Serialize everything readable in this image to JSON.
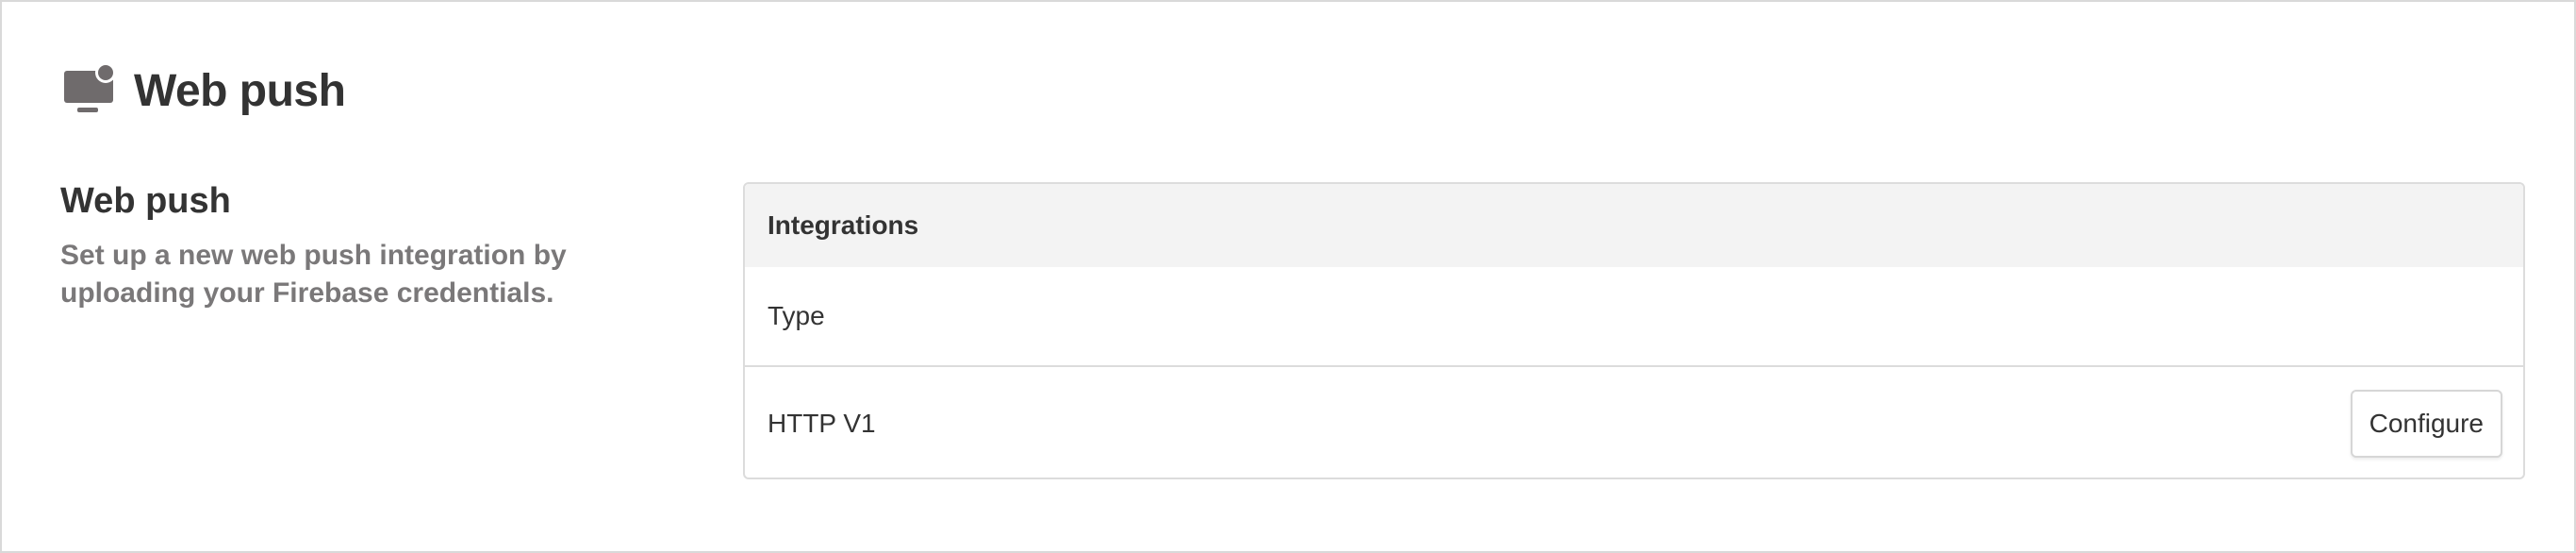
{
  "header": {
    "icon": "monitor-notification-icon",
    "title": "Web push"
  },
  "section": {
    "title": "Web push",
    "description_line1": "Set up a new web push integration by",
    "description_line2": "uploading your Firebase credentials."
  },
  "integrations": {
    "header": "Integrations",
    "column_label": "Type",
    "rows": [
      {
        "type": "HTTP V1",
        "action_label": "Configure"
      }
    ]
  },
  "colors": {
    "icon": "#6f6b6c",
    "text": "#333333",
    "muted_text": "#7a7879",
    "card_header_bg": "#f3f3f3",
    "border": "#dcdcdc"
  }
}
